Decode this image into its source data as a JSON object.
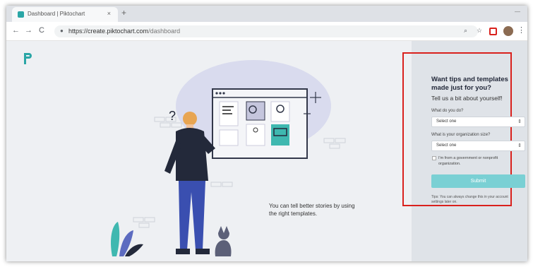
{
  "browser": {
    "tab_title": "Dashboard | Piktochart",
    "url_host": "https://create.piktochart.com",
    "url_path": "/dashboard",
    "new_tab": "+",
    "close": "×",
    "back": "←",
    "forward": "→",
    "reload": "C",
    "lock": "🔒",
    "zoom": "🔍",
    "star": "☆",
    "menu": "⋮"
  },
  "hero": {
    "tagline": "You can tell better stories by using the right templates."
  },
  "form": {
    "title": "Want tips and templates made just for you?",
    "subtitle": "Tell us a bit about yourself!",
    "q1_label": "What do you do?",
    "q1_value": "Select one",
    "q2_label": "What is your organization size?",
    "q2_value": "Select one",
    "checkbox_label": "I'm from a government or nonprofit organization.",
    "submit": "Submit",
    "tips": "Tips: You can always change this in your account settings later on."
  },
  "colors": {
    "accent": "#2aa6a6",
    "submit": "#7ad0d4",
    "highlight_box": "#d9211d"
  },
  "icons": [
    "piktochart-logo",
    "lock-icon",
    "zoom-icon",
    "star-icon",
    "extension-icon",
    "avatar",
    "menu-icon",
    "chevron-icon"
  ]
}
